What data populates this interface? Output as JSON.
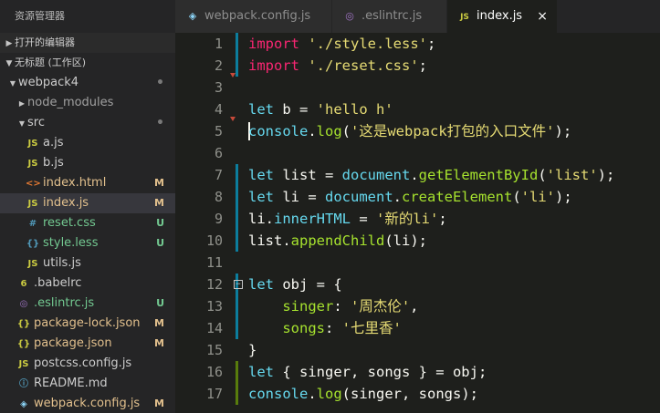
{
  "sidebar": {
    "title": "资源管理器",
    "open_editors": "打开的编辑器",
    "workspace": "无标题 (工作区)",
    "items": [
      {
        "name": "webpack4",
        "type": "folder-open",
        "indent": 0,
        "badge": "•",
        "status": "normal"
      },
      {
        "name": "node_modules",
        "type": "folder-closed",
        "indent": 1,
        "badge": "",
        "status": "dim"
      },
      {
        "name": "src",
        "type": "folder-open",
        "indent": 1,
        "badge": "•",
        "status": "normal"
      },
      {
        "name": "a.js",
        "type": "js",
        "indent": 2,
        "badge": "",
        "status": "normal"
      },
      {
        "name": "b.js",
        "type": "js",
        "indent": 2,
        "badge": "",
        "status": "normal"
      },
      {
        "name": "index.html",
        "type": "html",
        "indent": 2,
        "badge": "M",
        "status": "M"
      },
      {
        "name": "index.js",
        "type": "js",
        "indent": 2,
        "badge": "M",
        "status": "M",
        "selected": true
      },
      {
        "name": "reset.css",
        "type": "css",
        "indent": 2,
        "badge": "U",
        "status": "U"
      },
      {
        "name": "style.less",
        "type": "less",
        "indent": 2,
        "badge": "U",
        "status": "U"
      },
      {
        "name": "utils.js",
        "type": "js",
        "indent": 2,
        "badge": "",
        "status": "normal"
      },
      {
        "name": ".babelrc",
        "type": "babel",
        "indent": 1,
        "badge": "",
        "status": "normal"
      },
      {
        "name": ".eslintrc.js",
        "type": "eslint",
        "indent": 1,
        "badge": "U",
        "status": "U"
      },
      {
        "name": "package-lock.json",
        "type": "json",
        "indent": 1,
        "badge": "M",
        "status": "M"
      },
      {
        "name": "package.json",
        "type": "json",
        "indent": 1,
        "badge": "M",
        "status": "M"
      },
      {
        "name": "postcss.config.js",
        "type": "js",
        "indent": 1,
        "badge": "",
        "status": "normal"
      },
      {
        "name": "README.md",
        "type": "info",
        "indent": 1,
        "badge": "",
        "status": "normal"
      },
      {
        "name": "webpack.config.js",
        "type": "webpack",
        "indent": 1,
        "badge": "M",
        "status": "M"
      }
    ]
  },
  "tabs": [
    {
      "label": "webpack.config.js",
      "icon": "webpack-icon",
      "active": false
    },
    {
      "label": ".eslintrc.js",
      "icon": "eslint-icon",
      "active": false
    },
    {
      "label": "index.js",
      "icon": "js-icon",
      "active": true,
      "close": "×"
    }
  ],
  "icon_glyphs": {
    "js": "JS",
    "html": "<>",
    "css": "#",
    "less": "{}",
    "json": "{}",
    "babel": "6",
    "eslint": "◎",
    "info": "ⓘ",
    "webpack": "◈"
  },
  "colors": {
    "keyword": "#66d9ef",
    "import": "#f92672",
    "string": "#e6db74",
    "function": "#a6e22e",
    "modified": "#e2c08d",
    "untracked": "#73c991",
    "js_icon": "#cbcb41",
    "css_icon": "#519aba",
    "html_icon": "#e37933",
    "json_icon": "#cbcb41",
    "webpack_icon": "#8dd6f9",
    "eslint_icon": "#a074c4"
  },
  "editor": {
    "lines": [
      {
        "n": "1",
        "gutter": "blue",
        "tokens": [
          [
            "import",
            "k-import"
          ],
          [
            " ",
            ""
          ],
          [
            "'./style.less'",
            "k-str"
          ],
          [
            ";",
            "k-punc"
          ]
        ]
      },
      {
        "n": "2",
        "gutter": "blue",
        "tokens": [
          [
            "import",
            "k-import"
          ],
          [
            " ",
            ""
          ],
          [
            "'./reset.css'",
            "k-str"
          ],
          [
            ";",
            "k-punc"
          ]
        ]
      },
      {
        "n": "3",
        "gutter": "",
        "marker": true,
        "tokens": []
      },
      {
        "n": "4",
        "gutter": "",
        "tokens": [
          [
            "let",
            "k-kw"
          ],
          [
            " b = ",
            "k-var"
          ],
          [
            "'hello h'",
            "k-str"
          ]
        ]
      },
      {
        "n": "5",
        "gutter": "",
        "marker": true,
        "cursor": true,
        "tokens": [
          [
            "console",
            "k-kw"
          ],
          [
            ".",
            "k-punc"
          ],
          [
            "log",
            "k-fn"
          ],
          [
            "(",
            "k-punc"
          ],
          [
            "'这是webpack打包的入口文件'",
            "k-str"
          ],
          [
            ");",
            "k-punc"
          ]
        ]
      },
      {
        "n": "6",
        "gutter": "",
        "tokens": []
      },
      {
        "n": "7",
        "gutter": "blue",
        "tokens": [
          [
            "let",
            "k-kw"
          ],
          [
            " list = ",
            "k-var"
          ],
          [
            "document",
            "k-kw"
          ],
          [
            ".",
            "k-punc"
          ],
          [
            "getElementById",
            "k-fn"
          ],
          [
            "(",
            "k-punc"
          ],
          [
            "'list'",
            "k-str"
          ],
          [
            ");",
            "k-punc"
          ]
        ]
      },
      {
        "n": "8",
        "gutter": "blue",
        "tokens": [
          [
            "let",
            "k-kw"
          ],
          [
            " li = ",
            "k-var"
          ],
          [
            "document",
            "k-kw"
          ],
          [
            ".",
            "k-punc"
          ],
          [
            "createElement",
            "k-fn"
          ],
          [
            "(",
            "k-punc"
          ],
          [
            "'li'",
            "k-str"
          ],
          [
            ");",
            "k-punc"
          ]
        ]
      },
      {
        "n": "9",
        "gutter": "blue",
        "tokens": [
          [
            "li",
            "k-var"
          ],
          [
            ".",
            "k-punc"
          ],
          [
            "innerHTML",
            "k-kw"
          ],
          [
            " = ",
            "k-var"
          ],
          [
            "'新的li'",
            "k-str"
          ],
          [
            ";",
            "k-punc"
          ]
        ]
      },
      {
        "n": "10",
        "gutter": "blue",
        "tokens": [
          [
            "list",
            "k-var"
          ],
          [
            ".",
            "k-punc"
          ],
          [
            "appendChild",
            "k-fn"
          ],
          [
            "(li);",
            "k-punc"
          ]
        ]
      },
      {
        "n": "11",
        "gutter": "",
        "tokens": []
      },
      {
        "n": "12",
        "gutter": "blue",
        "fold": "−",
        "tokens": [
          [
            "let",
            "k-kw"
          ],
          [
            " obj = {",
            "k-var"
          ]
        ]
      },
      {
        "n": "13",
        "gutter": "blue",
        "tokens": [
          [
            "    singer",
            "k-prop"
          ],
          [
            ": ",
            "k-punc"
          ],
          [
            "'周杰伦'",
            "k-str"
          ],
          [
            ",",
            "k-punc"
          ]
        ]
      },
      {
        "n": "14",
        "gutter": "blue",
        "tokens": [
          [
            "    songs",
            "k-prop"
          ],
          [
            ": ",
            "k-punc"
          ],
          [
            "'七里香'",
            "k-str"
          ]
        ]
      },
      {
        "n": "15",
        "gutter": "",
        "tokens": [
          [
            "}",
            "k-punc"
          ]
        ]
      },
      {
        "n": "16",
        "gutter": "green",
        "tokens": [
          [
            "let",
            "k-kw"
          ],
          [
            " { singer, songs } = obj;",
            "k-var"
          ]
        ]
      },
      {
        "n": "17",
        "gutter": "green",
        "tokens": [
          [
            "console",
            "k-kw"
          ],
          [
            ".",
            "k-punc"
          ],
          [
            "log",
            "k-fn"
          ],
          [
            "(singer, songs);",
            "k-punc"
          ]
        ]
      }
    ]
  }
}
